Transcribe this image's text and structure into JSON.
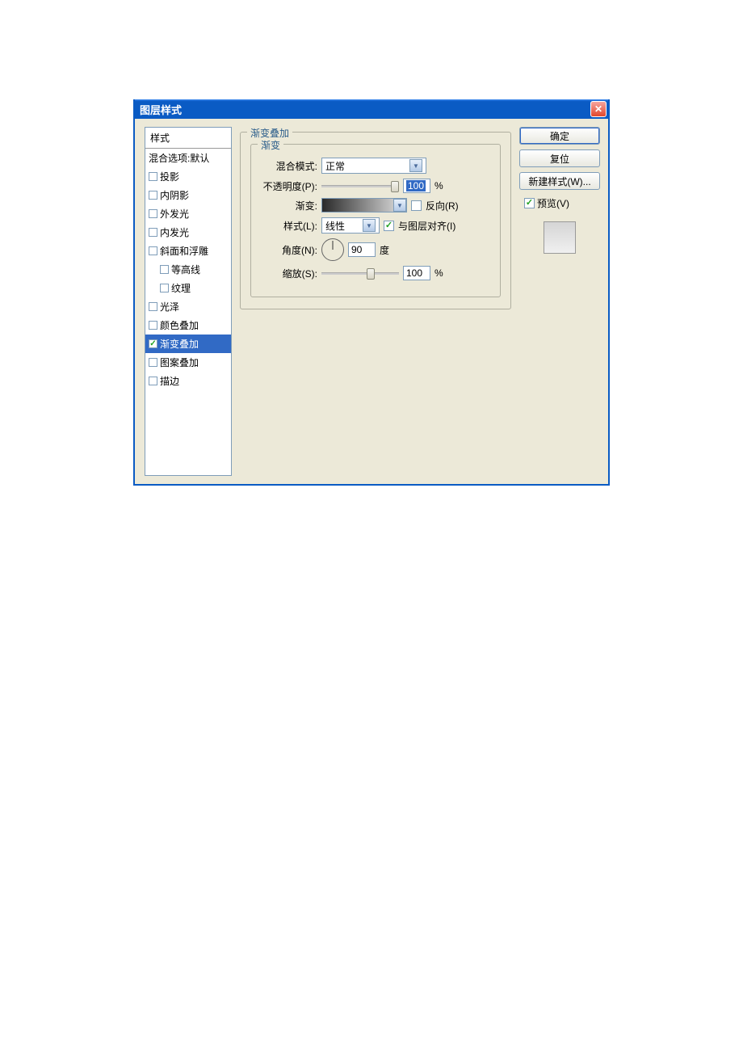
{
  "title": "图层样式",
  "close": "✕",
  "sidebar": {
    "header": "样式",
    "items": [
      {
        "label": "混合选项:默认",
        "checkbox": false,
        "checked": false,
        "indent": false,
        "selected": false
      },
      {
        "label": "投影",
        "checkbox": true,
        "checked": false,
        "indent": false,
        "selected": false
      },
      {
        "label": "内阴影",
        "checkbox": true,
        "checked": false,
        "indent": false,
        "selected": false
      },
      {
        "label": "外发光",
        "checkbox": true,
        "checked": false,
        "indent": false,
        "selected": false
      },
      {
        "label": "内发光",
        "checkbox": true,
        "checked": false,
        "indent": false,
        "selected": false
      },
      {
        "label": "斜面和浮雕",
        "checkbox": true,
        "checked": false,
        "indent": false,
        "selected": false
      },
      {
        "label": "等高线",
        "checkbox": true,
        "checked": false,
        "indent": true,
        "selected": false
      },
      {
        "label": "纹理",
        "checkbox": true,
        "checked": false,
        "indent": true,
        "selected": false
      },
      {
        "label": "光泽",
        "checkbox": true,
        "checked": false,
        "indent": false,
        "selected": false
      },
      {
        "label": "颜色叠加",
        "checkbox": true,
        "checked": false,
        "indent": false,
        "selected": false
      },
      {
        "label": "渐变叠加",
        "checkbox": true,
        "checked": true,
        "indent": false,
        "selected": true
      },
      {
        "label": "图案叠加",
        "checkbox": true,
        "checked": false,
        "indent": false,
        "selected": false
      },
      {
        "label": "描边",
        "checkbox": true,
        "checked": false,
        "indent": false,
        "selected": false
      }
    ]
  },
  "panel": {
    "outer_legend": "渐变叠加",
    "inner_legend": "渐变",
    "blend_mode_label": "混合模式:",
    "blend_mode_value": "正常",
    "opacity_label": "不透明度(P):",
    "opacity_value": "100",
    "percent": "%",
    "gradient_label": "渐变:",
    "reverse_label": "反向(R)",
    "style_label": "样式(L):",
    "style_value": "线性",
    "align_label": "与图层对齐(I)",
    "angle_label": "角度(N):",
    "angle_value": "90",
    "degree": "度",
    "scale_label": "缩放(S):",
    "scale_value": "100"
  },
  "buttons": {
    "ok": "确定",
    "reset": "复位",
    "new_style": "新建样式(W)...",
    "preview": "预览(V)"
  }
}
